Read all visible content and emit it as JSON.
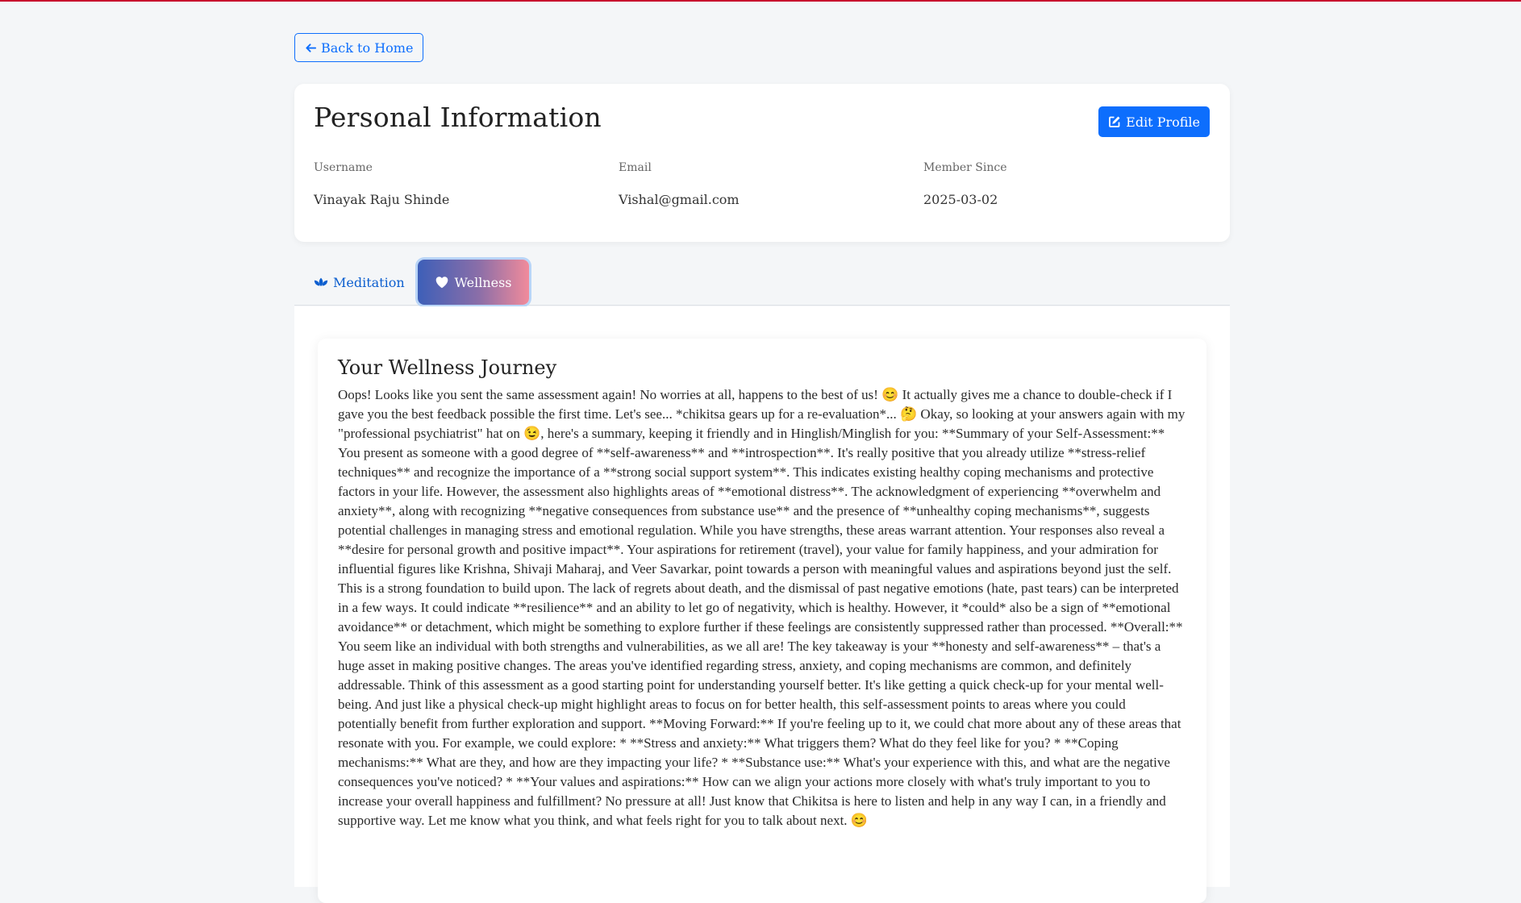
{
  "nav": {
    "back_label": "Back to Home"
  },
  "profile": {
    "title": "Personal Information",
    "edit_label": "Edit Profile",
    "fields": [
      {
        "label": "Username",
        "value": "Vinayak Raju Shinde"
      },
      {
        "label": "Email",
        "value": "Vishal@gmail.com"
      },
      {
        "label": "Member Since",
        "value": "2025-03-02"
      }
    ]
  },
  "tabs": [
    {
      "label": "Meditation",
      "icon": "lotus-icon",
      "active": false
    },
    {
      "label": "Wellness",
      "icon": "heart-icon",
      "active": true
    }
  ],
  "wellness": {
    "title": "Your Wellness Journey",
    "text": "Oops! Looks like you sent the same assessment again! No worries at all, happens to the best of us! 😊 It actually gives me a chance to double-check if I gave you the best feedback possible the first time. Let's see... *chikitsa gears up for a re-evaluation*... 🤔 Okay, so looking at your answers again with my \"professional psychiatrist\" hat on 😉, here's a summary, keeping it friendly and in Hinglish/Minglish for you: **Summary of your Self-Assessment:** You present as someone with a good degree of **self-awareness** and **introspection**. It's really positive that you already utilize **stress-relief techniques** and recognize the importance of a **strong social support system**. This indicates existing healthy coping mechanisms and protective factors in your life. However, the assessment also highlights areas of **emotional distress**. The acknowledgment of experiencing **overwhelm and anxiety**, along with recognizing **negative consequences from substance use** and the presence of **unhealthy coping mechanisms**, suggests potential challenges in managing stress and emotional regulation. While you have strengths, these areas warrant attention. Your responses also reveal a **desire for personal growth and positive impact**. Your aspirations for retirement (travel), your value for family happiness, and your admiration for influential figures like Krishna, Shivaji Maharaj, and Veer Savarkar, point towards a person with meaningful values and aspirations beyond just the self. This is a strong foundation to build upon. The lack of regrets about death, and the dismissal of past negative emotions (hate, past tears) can be interpreted in a few ways. It could indicate **resilience** and an ability to let go of negativity, which is healthy. However, it *could* also be a sign of **emotional avoidance** or detachment, which might be something to explore further if these feelings are consistently suppressed rather than processed. **Overall:** You seem like an individual with both strengths and vulnerabilities, as we all are! The key takeaway is your **honesty and self-awareness** – that's a huge asset in making positive changes. The areas you've identified regarding stress, anxiety, and coping mechanisms are common, and definitely addressable. Think of this assessment as a good starting point for understanding yourself better. It's like getting a quick check-up for your mental well-being. And just like a physical check-up might highlight areas to focus on for better health, this self-assessment points to areas where you could potentially benefit from further exploration and support. **Moving Forward:** If you're feeling up to it, we could chat more about any of these areas that resonate with you. For example, we could explore: * **Stress and anxiety:** What triggers them? What do they feel like for you? * **Coping mechanisms:** What are they, and how are they impacting your life? * **Substance use:** What's your experience with this, and what are the negative consequences you've noticed? * **Your values and aspirations:** How can we align your actions more closely with what's truly important to you to increase your overall happiness and fulfillment? No pressure at all! Just know that Chikitsa is here to listen and help in any way I can, in a friendly and supportive way. Let me know what you think, and what feels right for you to talk about next. 😊"
  },
  "colors": {
    "primary": "#0d6efd",
    "background": "#f4f6f8",
    "top_accent": "#c8102e"
  }
}
